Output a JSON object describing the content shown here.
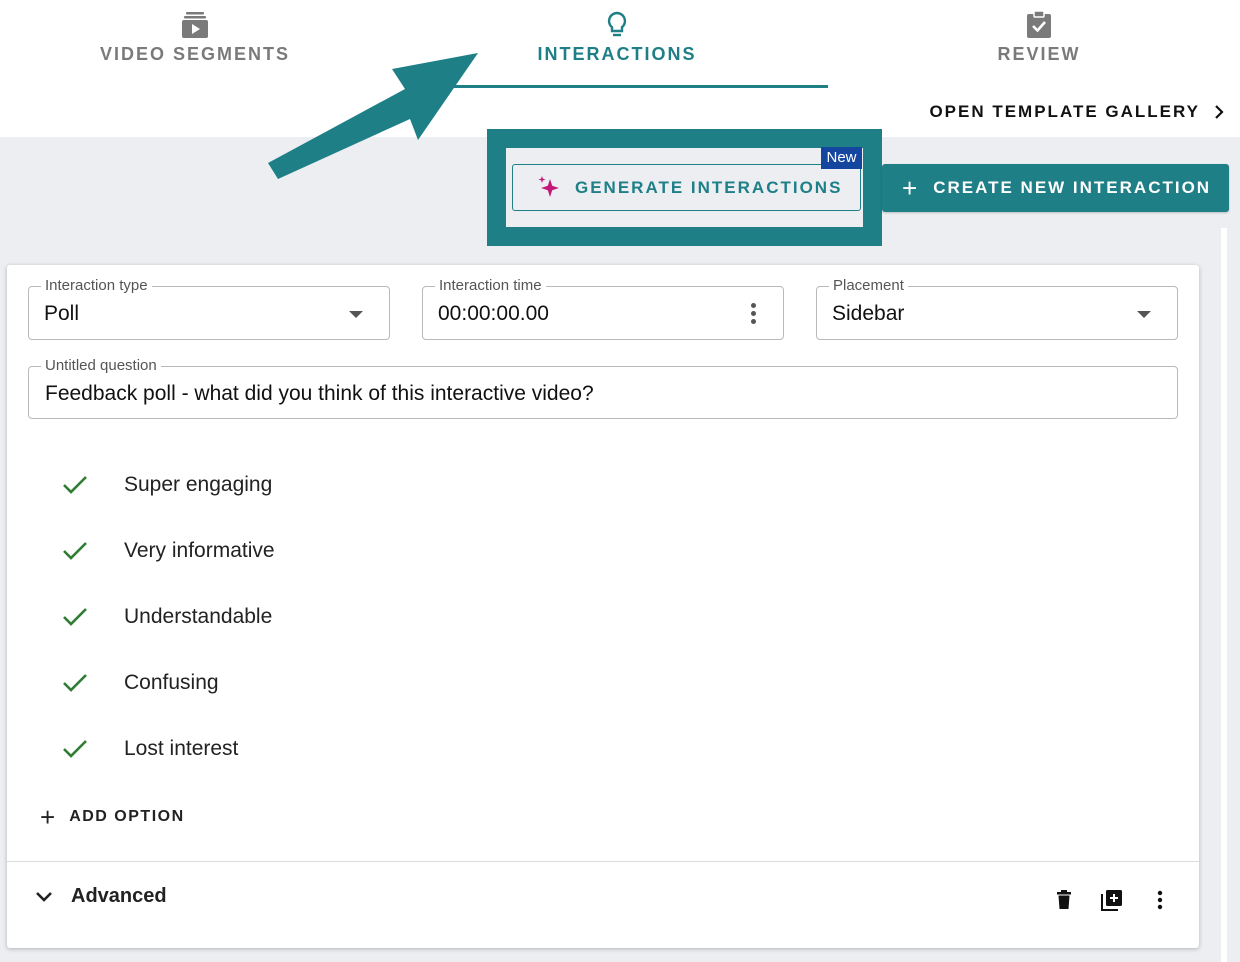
{
  "tabs": [
    {
      "label": "VIDEO SEGMENTS",
      "icon": "video-segments-icon",
      "active": false
    },
    {
      "label": "INTERACTIONS",
      "icon": "lightbulb-icon",
      "active": true
    },
    {
      "label": "REVIEW",
      "icon": "clipboard-check-icon",
      "active": false
    }
  ],
  "toolbar": {
    "gallery_label": "OPEN TEMPLATE GALLERY",
    "generate_label": "GENERATE INTERACTIONS",
    "new_badge": "New",
    "create_label": "CREATE NEW INTERACTION"
  },
  "form": {
    "type": {
      "label": "Interaction type",
      "value": "Poll"
    },
    "time": {
      "label": "Interaction time",
      "value": "00:00:00.00"
    },
    "placement": {
      "label": "Placement",
      "value": "Sidebar"
    },
    "question": {
      "label": "Untitled question",
      "value": "Feedback poll - what did you think of this interactive video?"
    }
  },
  "options": [
    {
      "label": "Super engaging"
    },
    {
      "label": "Very informative"
    },
    {
      "label": "Understandable"
    },
    {
      "label": "Confusing"
    },
    {
      "label": "Lost interest"
    }
  ],
  "add_option_label": "ADD OPTION",
  "advanced_label": "Advanced",
  "colors": {
    "accent": "#1e7f87",
    "badge": "#1446a0",
    "check": "#2e7d32",
    "sparkle": "#c2187a"
  }
}
